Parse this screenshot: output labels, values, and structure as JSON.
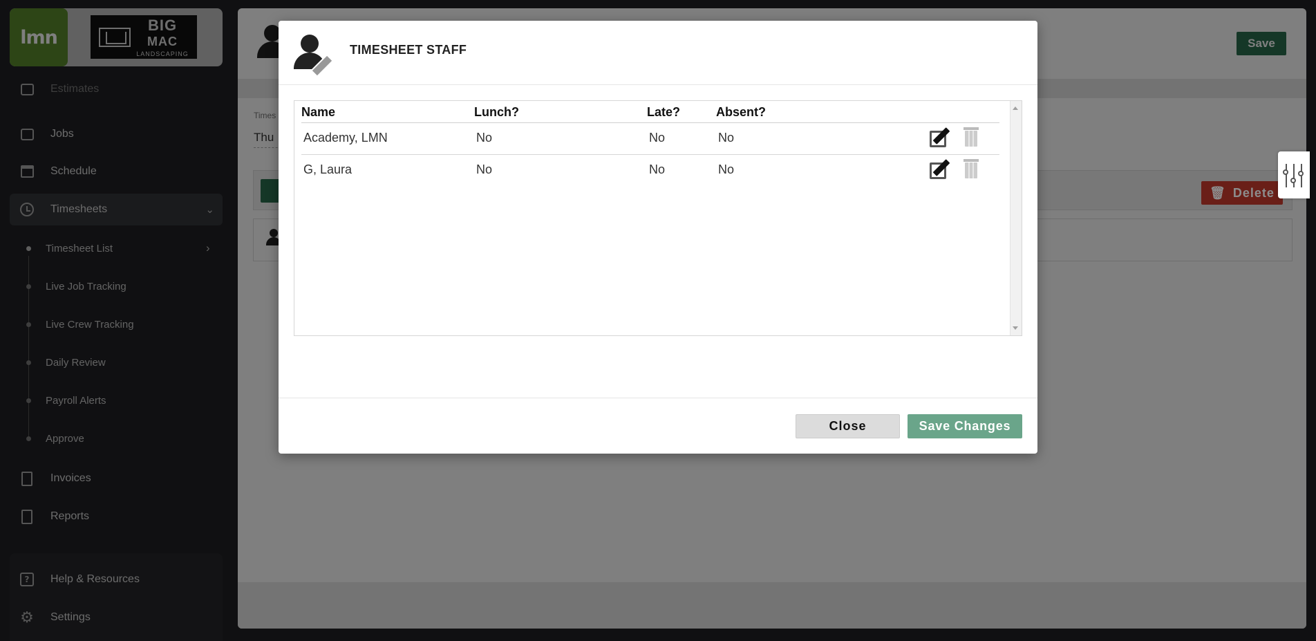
{
  "sidebar": {
    "brand": {
      "app_logo_text": "lmn",
      "company_big": "BIG",
      "company_mac": "MAC",
      "company_sub": "LANDSCAPING"
    },
    "items": [
      {
        "label": "Estimates",
        "icon": "calculator-icon"
      },
      {
        "label": "Jobs",
        "icon": "building-icon"
      },
      {
        "label": "Schedule",
        "icon": "calendar-icon"
      },
      {
        "label": "Timesheets",
        "icon": "clock-icon"
      },
      {
        "label": "Invoices",
        "icon": "invoice-icon"
      },
      {
        "label": "Reports",
        "icon": "report-icon"
      }
    ],
    "timesheet_sub": [
      {
        "label": "Timesheet List"
      },
      {
        "label": "Live Job Tracking"
      },
      {
        "label": "Live Crew Tracking"
      },
      {
        "label": "Daily Review"
      },
      {
        "label": "Payroll Alerts"
      },
      {
        "label": "Approve"
      }
    ],
    "bottom": [
      {
        "label": "Help & Resources",
        "icon": "help-icon"
      },
      {
        "label": "Settings",
        "icon": "gear-icon"
      }
    ]
  },
  "main": {
    "save_label": "Save",
    "timesheet_label": "Times",
    "date_text": "Thu",
    "delete_label": "Delete"
  },
  "modal": {
    "title": "TIMESHEET STAFF",
    "columns": {
      "name": "Name",
      "lunch": "Lunch?",
      "late": "Late?",
      "absent": "Absent?"
    },
    "rows": [
      {
        "name": "Academy, LMN",
        "lunch": "No",
        "late": "No",
        "absent": "No"
      },
      {
        "name": "G, Laura",
        "lunch": "No",
        "late": "No",
        "absent": "No"
      }
    ],
    "close_label": "Close",
    "save_changes_label": "Save Changes"
  },
  "colors": {
    "brand_green": "#5a8a2d",
    "primary_dark_green": "#2a6e4f",
    "save_changes_green": "#6aa58a",
    "delete_red": "#c0392b",
    "sidebar_bg": "#202124"
  }
}
